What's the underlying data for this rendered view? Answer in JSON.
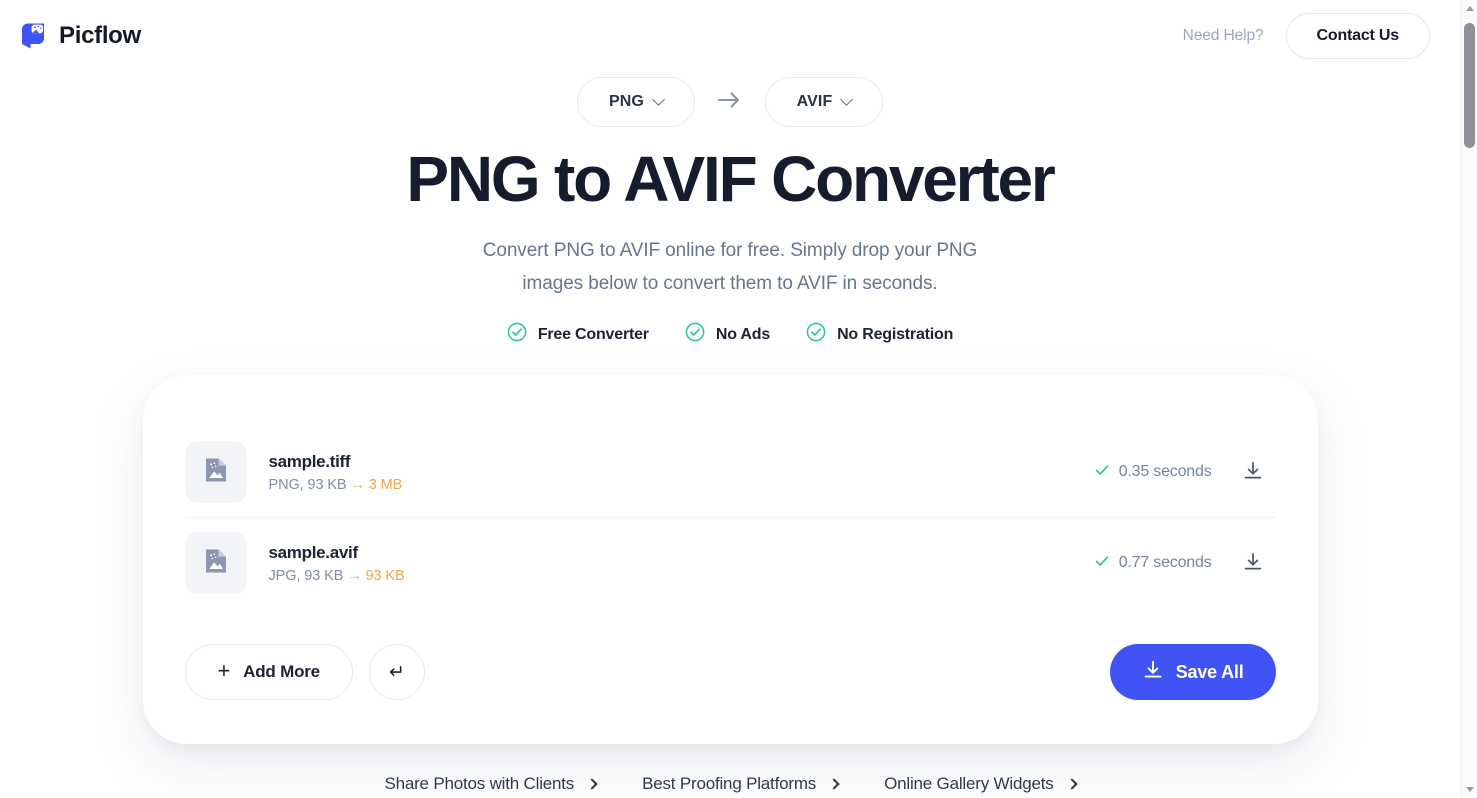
{
  "header": {
    "brand_name": "Picflow",
    "logo_icon": "picflow-logo-icon",
    "need_help": "Need Help?",
    "contact_label": "Contact Us"
  },
  "format_selector": {
    "source_format": "PNG",
    "target_format": "AVIF",
    "arrow_icon": "arrow-right-icon",
    "chevron_icon": "chevron-down-icon"
  },
  "hero": {
    "title": "PNG to AVIF Converter",
    "subtitle_line1": "Convert PNG to AVIF online for free. Simply drop your PNG",
    "subtitle_line2": "images below to convert them to AVIF in seconds.",
    "badges": [
      {
        "label": "Free Converter",
        "icon": "check-circle-icon"
      },
      {
        "label": "No Ads",
        "icon": "check-circle-icon"
      },
      {
        "label": "No Registration",
        "icon": "check-circle-icon"
      }
    ]
  },
  "files": [
    {
      "name": "sample.tiff",
      "source_format": "PNG",
      "source_size": "93 KB",
      "arrow": "→",
      "result_size": "3 MB",
      "timing": "0.35 seconds",
      "status_icon": "check-icon",
      "download_icon": "download-icon",
      "thumb_icon": "image-file-icon"
    },
    {
      "name": "sample.avif",
      "source_format": "JPG",
      "source_size": "93 KB",
      "arrow": "→",
      "result_size": "93 KB",
      "timing": "0.77 seconds",
      "status_icon": "check-icon",
      "download_icon": "download-icon",
      "thumb_icon": "image-file-icon"
    }
  ],
  "actions": {
    "add_more_label": "Add More",
    "add_more_icon": "plus-icon",
    "reset_icon": "return-arrow-icon",
    "reset_glyph": "↵",
    "save_all_label": "Save All",
    "save_all_icon": "download-icon"
  },
  "footer_links": [
    {
      "label": "Share Photos with Clients",
      "icon": "chevron-right-icon"
    },
    {
      "label": "Best Proofing Platforms",
      "icon": "chevron-right-icon"
    },
    {
      "label": "Online Gallery Widgets",
      "icon": "chevron-right-icon"
    }
  ],
  "colors": {
    "brand_blue": "#4054f5",
    "accent_orange": "#f0a64a",
    "success_green": "#2ecc8f",
    "text_dark": "#1c2333",
    "text_muted": "#68768d"
  },
  "scrollbar": {
    "up_icon": "scroll-up-arrow-icon",
    "down_icon": "scroll-down-arrow-icon"
  }
}
